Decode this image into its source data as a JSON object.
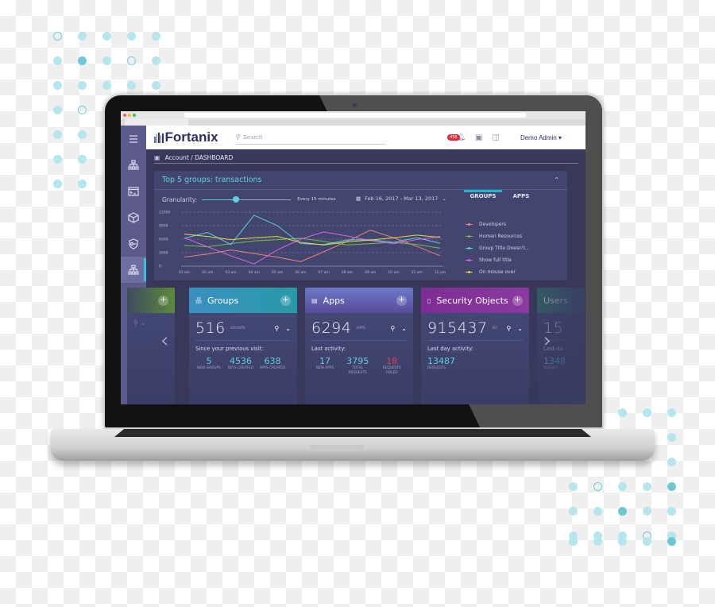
{
  "browser": {
    "traffic_colors": [
      "#fc5e57",
      "#fdbc2e",
      "#33c748"
    ]
  },
  "app": {
    "logo_text": "Fortanix",
    "search_placeholder": "Search",
    "notification_count": "456",
    "user_name": "Demo Admin",
    "user_caret": "▾"
  },
  "sidebar": {
    "items": [
      {
        "name": "menu",
        "icon": "hamburger-icon"
      },
      {
        "name": "groups",
        "icon": "hierarchy-icon"
      },
      {
        "name": "apps",
        "icon": "terminal-window-icon"
      },
      {
        "name": "security-objects",
        "icon": "cube-icon"
      },
      {
        "name": "security",
        "icon": "shield-key-icon"
      },
      {
        "name": "dashboard",
        "icon": "hierarchy-icon",
        "active": true
      },
      {
        "name": "audit-log",
        "icon": "document-search-icon"
      },
      {
        "name": "settings",
        "icon": "gears-icon"
      }
    ]
  },
  "breadcrumb": "Account / DASHBOARD",
  "panel": {
    "title": "Top 5 groups: transactions",
    "granularity_label": "Granularity:",
    "granularity_value": "Every 15 minutes",
    "granularity_position": 0.38,
    "date_range": "Feb 16, 2017 - Mar 13, 2017",
    "tabs": [
      {
        "label": "GROUPS",
        "active": true
      },
      {
        "label": "APPS",
        "active": false
      }
    ]
  },
  "chart_data": {
    "type": "line",
    "title": "Top 5 groups: transactions",
    "xlabel": "",
    "ylabel": "",
    "x": [
      "01 am",
      "02 am",
      "03 am",
      "04 am",
      "05 am",
      "06 am",
      "07 am",
      "08 am",
      "09 am",
      "10 am",
      "11 am",
      "12 pm"
    ],
    "yticks": [
      "0",
      "3000",
      "6000",
      "9000",
      "12000"
    ],
    "ylim": [
      0,
      12000
    ],
    "grid": true,
    "legend_position": "right",
    "series": [
      {
        "name": "Developers",
        "color": "#f07f7f",
        "values": [
          2000,
          2700,
          3600,
          2800,
          2000,
          1000,
          3200,
          5500,
          8000,
          6300,
          4400,
          2300
        ]
      },
      {
        "name": "Human Resources",
        "color": "#6fc23a",
        "values": [
          4600,
          4300,
          5000,
          5600,
          5900,
          6200,
          5500,
          4700,
          5000,
          5300,
          4800,
          4000
        ]
      },
      {
        "name": "Group Title Doesn't...",
        "color": "#5ecfe0",
        "values": [
          6200,
          7500,
          4800,
          11300,
          9000,
          5000,
          4800,
          5800,
          5900,
          5300,
          6300,
          5100
        ]
      },
      {
        "name": "Show full title",
        "color": "#e061e6",
        "values": [
          6300,
          4300,
          2300,
          500,
          3600,
          6000,
          7600,
          6700,
          5700,
          5000,
          5900,
          6600
        ]
      },
      {
        "name": "On mouse over",
        "color": "#e8d83a",
        "values": [
          7100,
          6600,
          5900,
          6300,
          6600,
          5300,
          4700,
          5400,
          5800,
          6300,
          6900,
          6400
        ]
      }
    ]
  },
  "cards": {
    "groups": {
      "title": "Groups",
      "count": "516",
      "unit": "GROUPS",
      "subtitle": "Since your previous visit:",
      "stats": [
        {
          "value": "5",
          "label": "NEW GROUPS"
        },
        {
          "value": "4536",
          "label": "KEYS CREATED"
        },
        {
          "value": "638",
          "label": "APPS CREATED"
        }
      ],
      "header_color": "#2e8fb0"
    },
    "apps": {
      "title": "Apps",
      "count": "6294",
      "unit": "APPS",
      "subtitle": "Last activity:",
      "stats": [
        {
          "value": "17",
          "label": "NEW APPS"
        },
        {
          "value": "3795",
          "label": "TOTAL REQUESTS"
        },
        {
          "value": "18",
          "label": "REQUESTS FAILED"
        }
      ],
      "header_color": "#6a5fb0"
    },
    "security_objects": {
      "title": "Security Objects",
      "count": "915437",
      "unit": "SO",
      "subtitle": "Last day activity:",
      "stats": [
        {
          "value": "13487",
          "label": "REQUESTS"
        }
      ],
      "header_color": "#8a2f9a"
    },
    "users_partial": {
      "title": "Users",
      "count": "15",
      "subtitle": "Last da",
      "stat_value": "1348",
      "stat_label": "REQUES"
    }
  },
  "nav": {
    "prev": "‹",
    "next": "›"
  }
}
